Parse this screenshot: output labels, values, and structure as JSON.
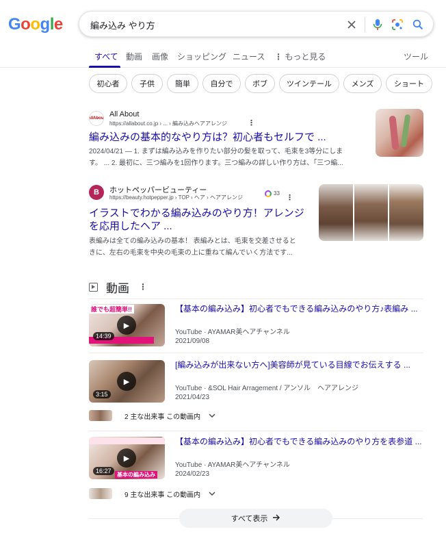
{
  "search": {
    "query": "編み込み やり方"
  },
  "tabs": [
    {
      "label": "すべて"
    },
    {
      "label": "動画"
    },
    {
      "label": "画像"
    },
    {
      "label": "ショッピング"
    },
    {
      "label": "ニュース"
    },
    {
      "label": "もっと見る"
    }
  ],
  "tools_label": "ツール",
  "chips": [
    "初心者",
    "子供",
    "簡単",
    "自分で",
    "ボブ",
    "ツインテール",
    "メンズ",
    "ショート"
  ],
  "results": [
    {
      "site": "All About",
      "favicon_text": "AllAbout",
      "url": "https://allabout.co.jp › ... › 編み込みヘアアレンジ",
      "title": "編み込みの基本的なやり方は？初心者もセルフで ...",
      "snippet_line1": "2024/04/21 — 1. まずは編み込みを作りたい部分の髪を取って、毛束を3等分にしま",
      "snippet_line2": "す。 ... 2. 最初に、三つ編みを1回作ります。三つ編みの詳しい作り方は、「三つ編..."
    },
    {
      "site": "ホットペッパービューティー",
      "favicon_text": "B",
      "url": "https://beauty.hotpepper.jp › TOP › ヘア › ヘアアレンジ",
      "badge": "33",
      "title_line1": "イラストでわかる編み込みのやり方！アレンジ",
      "title_line2": "を応用したヘア ...",
      "snippet_line1": "表編みは全ての編み込みの基本！ 表編みとは、毛束を交差させると",
      "snippet_line2": "きに、左右の毛束を中央の毛束の上に重ねて編んでいく方法です..."
    }
  ],
  "videos_section": {
    "title": "動画",
    "items": [
      {
        "title": "【基本の編み込み】初心者でもできる編み込みのやり方♪表編み ...",
        "source": "YouTube · AYAMAR美ヘアチャンネル",
        "date": "2021/09/08",
        "duration": "14:39",
        "thumb_caption": "誰でも超簡単!!"
      },
      {
        "title": "[編み込みが出来ない方へ]美容師が見ている目線でお伝えする ...",
        "source": "YouTube · &SOL Hair Arragement / アンソル　ヘアアレンジ",
        "date": "2021/04/23",
        "duration": "3:15",
        "moments": "2 主な出来事 この動画内"
      },
      {
        "title": "【基本の編み込み】初心者でもできる編み込みのやり方を表参道 ...",
        "source": "YouTube · AYAMAR美ヘアチャンネル",
        "date": "2024/02/23",
        "duration": "16:27",
        "thumb_caption": "基本の編み込み",
        "moments": "9 主な出来事 この動画内"
      }
    ],
    "show_all": "すべて表示"
  }
}
